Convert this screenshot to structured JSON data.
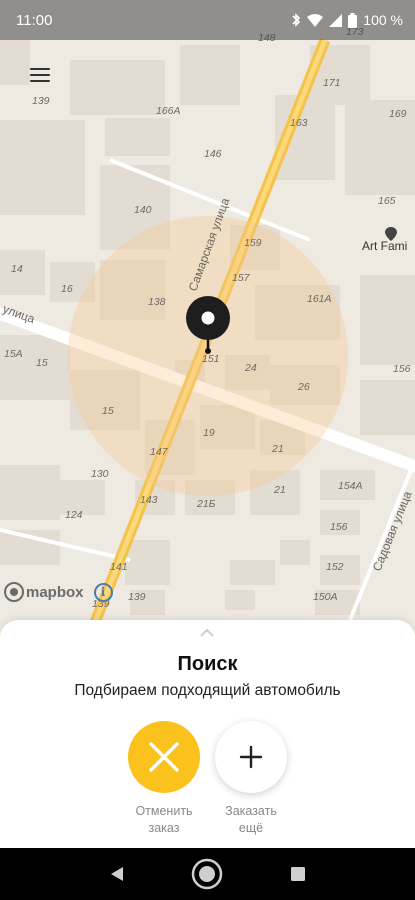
{
  "status_bar": {
    "time": "11:00",
    "battery": "100 %"
  },
  "map": {
    "street_names": [
      "Самарская улица",
      "улица",
      "Садовая улица"
    ],
    "poi_label": "Art Fami",
    "house_numbers": [
      "148",
      "173",
      "171",
      "139",
      "166А",
      "163",
      "169",
      "146",
      "140",
      "165",
      "159",
      "157",
      "14",
      "16",
      "161А",
      "138",
      "15А",
      "15",
      "24",
      "26",
      "156",
      "15",
      "19",
      "147",
      "21",
      "130",
      "154А",
      "143",
      "21Б",
      "21",
      "124",
      "156",
      "141",
      "139",
      "152",
      "139",
      "150А",
      "151"
    ]
  },
  "attribution": {
    "brand": "mapbox"
  },
  "bottom_sheet": {
    "title": "Поиск",
    "subtitle": "Подбираем подходящий автомобиль",
    "cancel_label": "Отменить\nзаказ",
    "order_more_label": "Заказать\nещё"
  },
  "colors": {
    "accent": "#fbc21d",
    "road_main": "#f5c24a",
    "search_radius": "#f6c98e"
  }
}
